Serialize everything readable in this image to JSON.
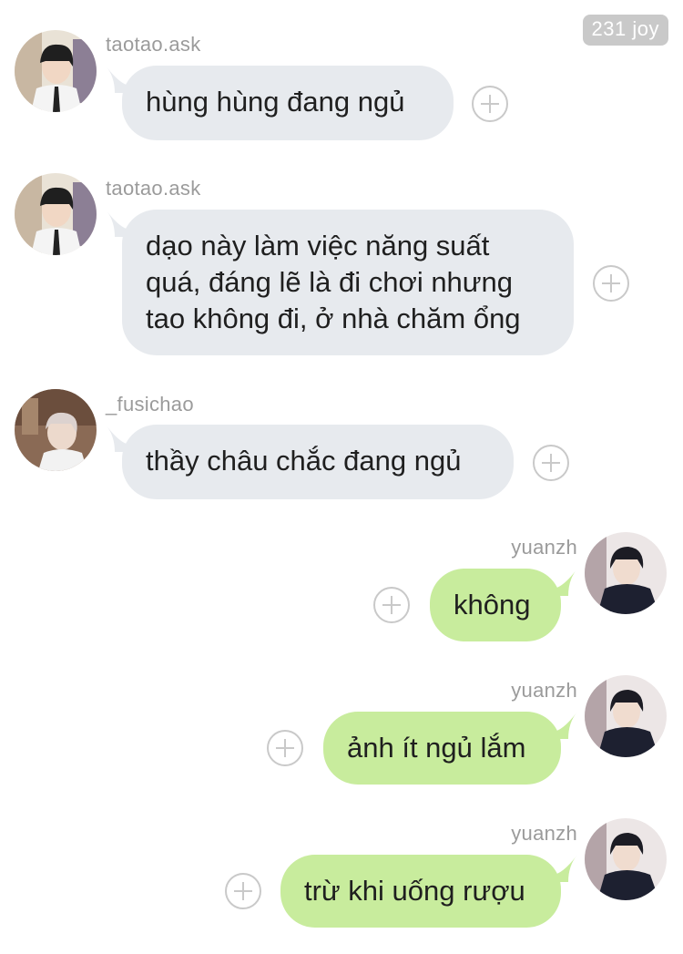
{
  "watermark": "231 joy",
  "messages": [
    {
      "sender": "taotao.ask",
      "direction": "incoming",
      "text": "hùng hùng đang ngủ",
      "avatar": "avatar-taotao"
    },
    {
      "sender": "taotao.ask",
      "direction": "incoming",
      "text": "dạo này làm việc năng suất quá, đáng lẽ là đi chơi nhưng tao không đi, ở nhà chăm ổng",
      "lines": [
        "dạo này làm việc năng suất",
        "quá, đáng lẽ là đi chơi nhưng",
        "tao không đi, ở nhà chăm ổng"
      ],
      "avatar": "avatar-taotao"
    },
    {
      "sender": "_fusichao",
      "direction": "incoming",
      "text": "thầy châu chắc đang ngủ",
      "avatar": "avatar-fusichao"
    },
    {
      "sender": "yuanzh",
      "direction": "outgoing",
      "text": "không",
      "avatar": "avatar-yuanzh"
    },
    {
      "sender": "yuanzh",
      "direction": "outgoing",
      "text": "ảnh ít ngủ lắm",
      "avatar": "avatar-yuanzh"
    },
    {
      "sender": "yuanzh",
      "direction": "outgoing",
      "text": "trừ khi uống rượu",
      "avatar": "avatar-yuanzh"
    }
  ],
  "colors": {
    "incoming_bubble": "#e7eaee",
    "outgoing_bubble": "#c8ec9d",
    "name": "#9b9b9b",
    "plus": "#c9c9c9"
  }
}
